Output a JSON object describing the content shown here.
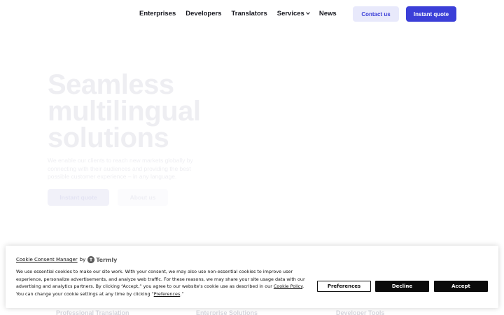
{
  "nav": {
    "links": [
      "Enterprises",
      "Developers",
      "Translators",
      "Services",
      "News"
    ],
    "contact_label": "Contact us",
    "quote_label": "Instant quote"
  },
  "hero": {
    "title_line1": "Seamless",
    "title_line2": "multilingual",
    "title_line3": "solutions",
    "subtitle": "We enable our clients to reach new markets globally by connecting with their audiences and providing the best possible customer experience – in any language.",
    "primary_button": "Instant quote",
    "secondary_button": "About us"
  },
  "sections": {
    "col1": "Professional Translation",
    "col2": "Enterprise Solutions",
    "col3": "Developer Tools"
  },
  "cookie": {
    "manager_label": "Cookie Consent Manager",
    "by": "by",
    "brand": "Termly",
    "text_part1": "We use essential cookies to make our site work. With your consent, we may also use non-essential cookies to improve user experience, personalize advertisements, and analyze web traffic. For these reasons, we may share your site usage data with our advertising and analytics partners. By clicking “Accept,” you agree to our website's cookie use as described in our ",
    "policy_link": "Cookie Policy",
    "text_part2": ". You can change your cookie settings at any time by clicking “",
    "preferences_link": "Preferences",
    "text_part3": ".”",
    "preferences_button": "Preferences",
    "decline_button": "Decline",
    "accept_button": "Accept"
  },
  "colors": {
    "brand": "#3b3fd8",
    "brand_light": "#e8e9fb"
  }
}
